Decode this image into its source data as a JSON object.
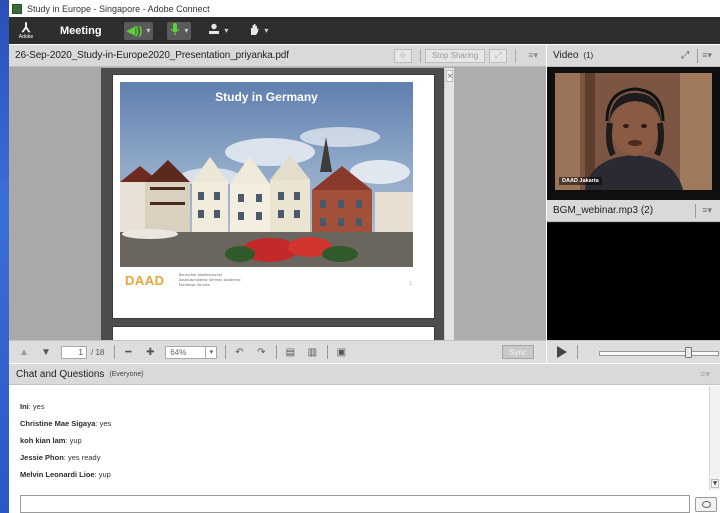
{
  "window": {
    "title": "Study in Europe - Singapore - Adobe Connect"
  },
  "menubar": {
    "logo_text": "Adobe",
    "meeting_label": "Meeting",
    "icons": [
      "speaker-icon",
      "microphone-icon",
      "camera-person-icon",
      "raise-hand-icon"
    ]
  },
  "share_pod": {
    "document_name": "26-Sep-2020_Study-in-Europe2020_Presentation_priyanka.pdf",
    "stop_sharing_label": "Stop Sharing",
    "menu_glyph": "≡▾",
    "slide": {
      "title": "Study in Germany",
      "logo_text": "DAAD",
      "logo_subtext": "Deutscher Akademischer Austauschdienst German Academic Exchange Service"
    },
    "toolbar": {
      "current_page": "1",
      "total_pages": "/ 18",
      "zoom": "64%",
      "sync_label": "Sync"
    }
  },
  "video_pod": {
    "title": "Video",
    "count": "(1)",
    "menu_glyph": "≡▾",
    "participant_label": "DAAD Jakarta"
  },
  "audio_pod": {
    "title": "BGM_webinar.mp3 (2)",
    "menu_glyph": "≡▾",
    "volume_level": 0.72
  },
  "chat_pod": {
    "title": "Chat and Questions",
    "scope": "(Everyone)",
    "menu_glyph": "≡▾",
    "messages": [
      {
        "author": "Ini",
        "text": "yes"
      },
      {
        "author": "Christine Mae Sigaya",
        "text": "yes"
      },
      {
        "author": "koh kian lam",
        "text": "yup"
      },
      {
        "author": "Jessie Phon",
        "text": "yes ready"
      },
      {
        "author": "Melvin Leonardi Lioe",
        "text": "yup"
      }
    ],
    "input_placeholder": ""
  },
  "colors": {
    "menubar_bg": "#2e2e2e",
    "pod_header_bg": "#d9d9d9",
    "accent_green": "#5ed336",
    "daad_orange": "#e8a63a"
  }
}
